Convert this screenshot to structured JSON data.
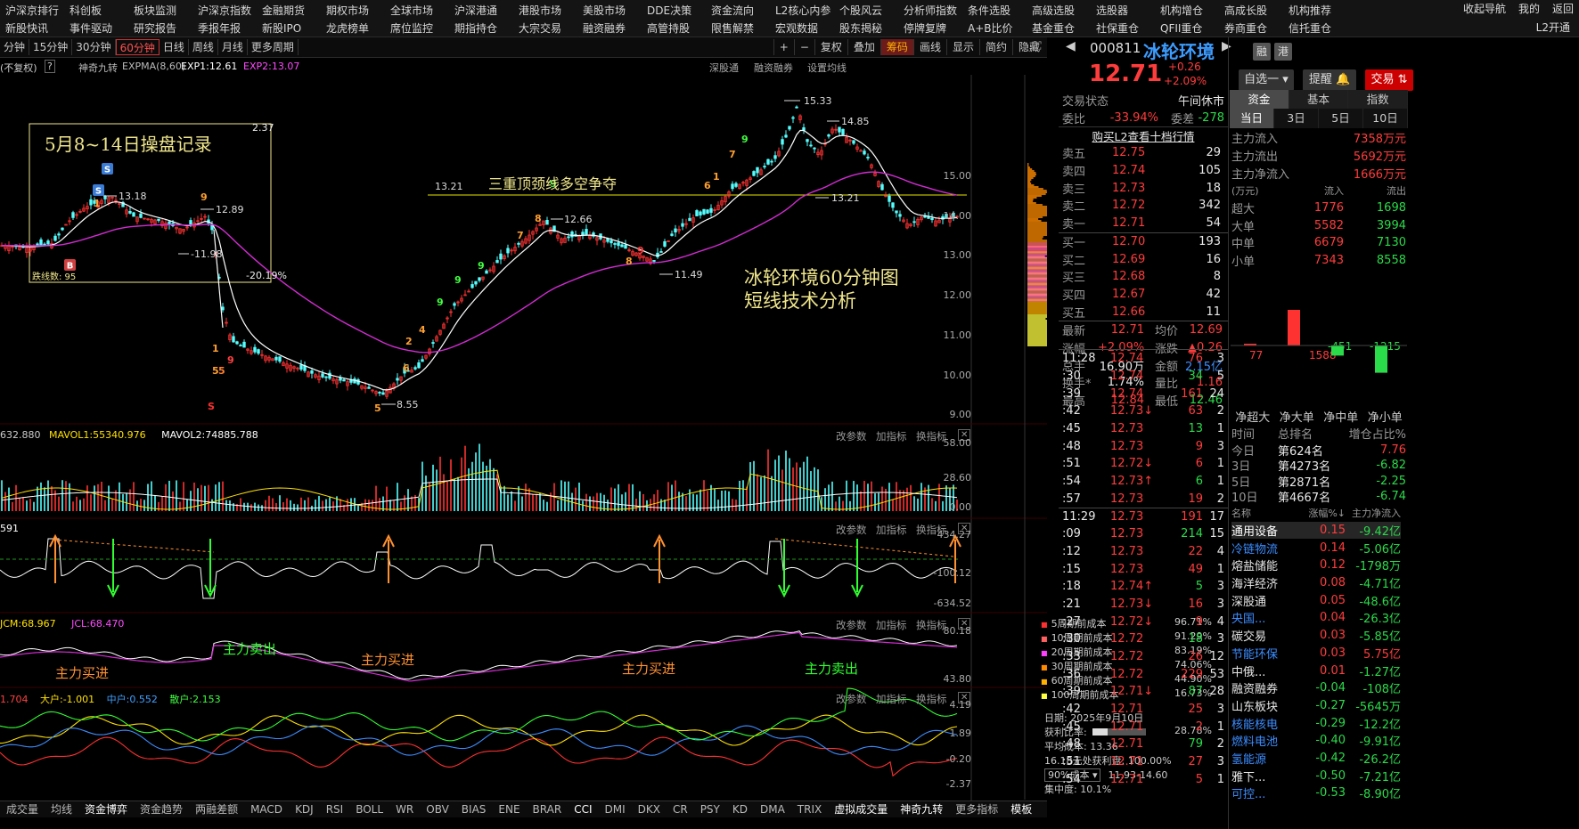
{
  "top_menu_row1": [
    "沪深京排行",
    "科创板",
    "板块监测",
    "沪深京指数",
    "金融期货",
    "期权市场",
    "全球市场",
    "沪深港通",
    "港股市场",
    "美股市场",
    "DDE决策",
    "资金流向",
    "L2核心内参",
    "个股风云",
    "分析师指数",
    "条件选股",
    "高级选股",
    "选股器",
    "机构增仓",
    "高成长股",
    "机构推荐"
  ],
  "top_menu_row2": [
    "新股快讯",
    "事件驱动",
    "研究报告",
    "季报年报",
    "新股IPO",
    "龙虎榜单",
    "席位监控",
    "期指持仓",
    "大宗交易",
    "融资融券",
    "高管持股",
    "限售解禁",
    "宏观数据",
    "股东揭秘",
    "停牌复牌",
    "A+B比价",
    "基金重仓",
    "社保重仓",
    "QFII重仓",
    "券商重仓",
    "信托重仓"
  ],
  "top_right": [
    "收起导航",
    "我的",
    "返回",
    "L2开通"
  ],
  "periods": [
    "分钟",
    "15分钟",
    "30分钟",
    "60分钟",
    "日线",
    "周线",
    "月线",
    "更多周期"
  ],
  "active_period": "60分钟",
  "chart_tools": [
    "+",
    "−",
    "复权",
    "叠加",
    "筹码",
    "画线",
    "显示",
    "简约",
    "隐藏"
  ],
  "header": {
    "fq": "(不复权)",
    "q": "?",
    "ind": "神奇九转",
    "expma": "EXPMA(8,60)",
    "exp1": "EXP1:12.61",
    "exp2": "EXP2:13.07",
    "links": [
      "深股通",
      "融资融券",
      "设置均线"
    ]
  },
  "annotations": {
    "box_title": "5月8~14日操盘记录",
    "box_hi": "2.37",
    "box_pct": "-20.19%",
    "box_pivot": "-11.98",
    "box_top": "13.18",
    "box_top2": "12.89",
    "box_count": "跌线数: 95",
    "neck_price": "13.21",
    "neck_text": "三重顶颈线多空争夺",
    "neck_right": "13.21",
    "peak": "15.33",
    "peak2": "14.85",
    "high_1266": "12.66",
    "low_1149": "11.49",
    "low_855": "8.55",
    "chart_title": "冰轮环境60分钟图",
    "chart_sub": "短线技术分析"
  },
  "y_axis": [
    "15.00",
    "14.00",
    "13.00",
    "12.00",
    "11.00",
    "10.00",
    "9.00"
  ],
  "vol_hdr": {
    "a": "632.880",
    "b": "MAVOL1:55340.976",
    "c": "MAVOL2:74885.788"
  },
  "vol_axis": [
    "58.00",
    "28.60",
    "0.00"
  ],
  "cci_hdr": "591",
  "cci_axis": [
    "434.27",
    "-100.12",
    "-634.52"
  ],
  "jcm_hdr": {
    "a": "JCM:68.967",
    "b": "JCL:68.470"
  },
  "jcm_axis": [
    "80.18",
    "43.80"
  ],
  "jcm_labels": [
    "主力买进",
    "主力卖出",
    "主力买进",
    "主力买进",
    "主力卖出"
  ],
  "flow_hdr": {
    "a": "1.704",
    "b": "大户:-1.001",
    "c": "中户:0.552",
    "d": "散户:2.153"
  },
  "flow_axis": [
    "4.19",
    "1.89",
    "-0.20",
    "-2.37"
  ],
  "panel_btns": [
    "改参数",
    "加指标",
    "换指标"
  ],
  "cost": {
    "rows": [
      [
        "5周期前成本",
        "96.71%"
      ],
      [
        "10周期前成本",
        "91.29%"
      ],
      [
        "20周期前成本",
        "83.19%"
      ],
      [
        "30周期前成本",
        "74.06%"
      ],
      [
        "60周期前成本",
        "44.90%"
      ],
      [
        "100周期前成本",
        "16.73%"
      ]
    ],
    "colors": [
      "#ff3030",
      "#ff6060",
      "#ff40ff",
      "#ff8a00",
      "#ffb000",
      "#ffff40"
    ],
    "date": "日期: 2025年9月10日",
    "profit_lbl": "获利比率:",
    "profit": "28.78%",
    "profit_frac": 0.2878,
    "avg": "平均成本: 13.36",
    "p100": "16.18元处获利盘: 100.00%",
    "range_sel": "90%成本",
    "range": "11.93-14.60",
    "conc": "集中度: 10.1%"
  },
  "bottom_tabs": [
    "成交量",
    "均线",
    "资金博弈",
    "资金趋势",
    "两融差额",
    "MACD",
    "KDJ",
    "RSI",
    "BOLL",
    "WR",
    "OBV",
    "BIAS",
    "ENE",
    "BRAR",
    "CCI",
    "DMI",
    "DKX",
    "CR",
    "PSY",
    "KD",
    "DMA",
    "TRIX",
    "虚拟成交量",
    "神奇九转",
    "更多指标",
    "模板"
  ],
  "stock": {
    "code": "000811",
    "name": "冰轮环境",
    "price": "12.71",
    "chg": "+0.26",
    "pct": "+2.09%",
    "btn1": "融",
    "btn2": "港",
    "sel": "自选一",
    "alert": "提醒",
    "trade": "交易"
  },
  "status": {
    "label": "交易状态",
    "value": "午间休市"
  },
  "weibi": {
    "label": "委比",
    "value": "-33.94%",
    "label2": "委差",
    "value2": "-278"
  },
  "l2link": "购买L2查看十档行情",
  "sells": [
    [
      "卖五",
      "12.75",
      "29"
    ],
    [
      "卖四",
      "12.74",
      "105"
    ],
    [
      "卖三",
      "12.73",
      "18"
    ],
    [
      "卖二",
      "12.72",
      "342"
    ],
    [
      "卖一",
      "12.71",
      "54"
    ]
  ],
  "buys": [
    [
      "买一",
      "12.70",
      "193"
    ],
    [
      "买二",
      "12.69",
      "16"
    ],
    [
      "买三",
      "12.68",
      "8"
    ],
    [
      "买四",
      "12.67",
      "42"
    ],
    [
      "买五",
      "12.66",
      "11"
    ]
  ],
  "quote": [
    [
      "最新",
      "12.71",
      "均价",
      "12.69"
    ],
    [
      "涨幅",
      "+2.09%",
      "涨跌",
      "▲0.26"
    ],
    [
      "总手",
      "16.90万",
      "金额",
      "2.15亿"
    ],
    [
      "换手*",
      "1.74%",
      "量比",
      "1.16"
    ],
    [
      "最高",
      "12.84",
      "最低",
      "12.46"
    ]
  ],
  "ticks": [
    [
      "11:28",
      "12.74",
      "76",
      "3"
    ],
    [
      ":30",
      "12.74",
      "34",
      "5"
    ],
    [
      ":39",
      "12.74",
      "161",
      "24"
    ],
    [
      ":42",
      "12.73↓",
      "63",
      "2"
    ],
    [
      ":45",
      "12.73",
      "13",
      "1"
    ],
    [
      ":48",
      "12.73",
      "9",
      "3"
    ],
    [
      ":51",
      "12.72↓",
      "6",
      "1"
    ],
    [
      ":54",
      "12.73↑",
      "6",
      "1"
    ],
    [
      ":57",
      "12.73",
      "19",
      "2"
    ],
    [
      "11:29",
      "12.73",
      "191",
      "17"
    ],
    [
      ":09",
      "12.73",
      "214",
      "15"
    ],
    [
      ":12",
      "12.73",
      "22",
      "4"
    ],
    [
      ":15",
      "12.73",
      "49",
      "1"
    ],
    [
      ":18",
      "12.74↑",
      "5",
      "3"
    ],
    [
      ":21",
      "12.73↓",
      "16",
      "3"
    ],
    [
      ":27",
      "12.72↓",
      "9",
      "4"
    ],
    [
      ":30",
      "12.72",
      "18",
      "3"
    ],
    [
      ":33",
      "12.72",
      "26",
      "12"
    ],
    [
      ":36",
      "12.72",
      "229",
      "53"
    ],
    [
      ":39",
      "12.71↓",
      "87",
      "28"
    ],
    [
      ":42",
      "12.71",
      "25",
      "3"
    ],
    [
      ":45",
      "12.71",
      "2",
      "1"
    ],
    [
      ":48",
      "12.71",
      "79",
      "2"
    ],
    [
      ":51",
      "12.71",
      "27",
      "3"
    ],
    [
      ":54",
      "12.71",
      "5",
      "1"
    ]
  ],
  "fund_tabs": [
    "资金",
    "基本",
    "指数"
  ],
  "period_tabs": [
    "当日",
    "3日",
    "5日",
    "10日"
  ],
  "main_flow": [
    [
      "主力流入",
      "7358万元"
    ],
    [
      "主力流出",
      "5692万元"
    ],
    [
      "主力净流入",
      "1666万元"
    ]
  ],
  "flow_table": {
    "unit": "(万元)",
    "hin": "流入",
    "hout": "流出",
    "rows": [
      [
        "超大",
        "1776",
        "1698"
      ],
      [
        "大单",
        "5582",
        "3994"
      ],
      [
        "中单",
        "6679",
        "7130"
      ],
      [
        "小单",
        "7343",
        "8558"
      ]
    ]
  },
  "net_bars": {
    "values": [
      77,
      1588,
      -451,
      -1215
    ],
    "labels": [
      "净超大",
      "净大单",
      "净中单",
      "净小单"
    ]
  },
  "rank": {
    "head": [
      "时间",
      "总排名",
      "增仓占比%"
    ],
    "rows": [
      [
        "今日",
        "第624名",
        "7.76"
      ],
      [
        "3日",
        "第4273名",
        "-6.82"
      ],
      [
        "5日",
        "第2871名",
        "-2.25"
      ],
      [
        "10日",
        "第4667名",
        "-6.74"
      ]
    ]
  },
  "sector": {
    "head": [
      "名称",
      "涨幅%↓",
      "主力净流入"
    ],
    "rows": [
      [
        "通用设备",
        "0.15",
        "-9.42亿"
      ],
      [
        "冷链物流",
        "0.14",
        "-5.06亿"
      ],
      [
        "熔盐储能",
        "0.12",
        "-1798万"
      ],
      [
        "海洋经济",
        "0.08",
        "-4.71亿"
      ],
      [
        "深股通",
        "0.05",
        "-48.6亿"
      ],
      [
        "央国...",
        "0.04",
        "-26.3亿"
      ],
      [
        "碳交易",
        "0.03",
        "-5.85亿"
      ],
      [
        "节能环保",
        "0.03",
        "5.75亿"
      ],
      [
        "中俄...",
        "0.01",
        "-1.27亿"
      ],
      [
        "融资融券",
        "-0.04",
        "-108亿"
      ],
      [
        "山东板块",
        "-0.27",
        "-5645万"
      ],
      [
        "核能核电",
        "-0.29",
        "-12.2亿"
      ],
      [
        "燃料电池",
        "-0.40",
        "-9.91亿"
      ],
      [
        "氢能源",
        "-0.42",
        "-26.2亿"
      ],
      [
        "雅下...",
        "-0.50",
        "-7.21亿"
      ],
      [
        "可控...",
        "-0.53",
        "-8.90亿"
      ]
    ],
    "cyan": [
      1,
      5,
      7,
      11,
      12,
      13,
      15
    ]
  }
}
